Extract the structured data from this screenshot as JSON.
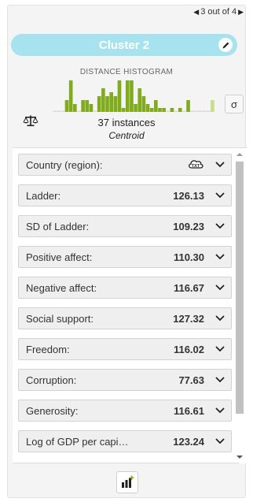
{
  "pager": {
    "text": "3 out of 4"
  },
  "cluster": {
    "name": "Cluster 2",
    "accent": "#a6e3ef"
  },
  "histogram": {
    "title": "DISTANCE HISTOGRAM",
    "bar_color": "#80ab1f",
    "highlight_color": "#c6de84",
    "empty_color": "#d8d8d8",
    "bins": [
      0,
      0,
      0,
      3,
      8,
      2,
      0,
      3,
      3,
      2,
      0,
      4,
      6,
      4,
      5,
      4,
      8,
      1,
      8,
      8,
      2,
      6,
      4,
      2,
      1,
      3,
      1,
      1,
      0,
      1,
      0,
      1,
      0,
      3,
      0,
      0,
      0,
      0,
      0,
      3
    ],
    "highlight_bins": [
      39
    ]
  },
  "sigma_button": {
    "label": "σ"
  },
  "summary": {
    "instances": "37 instances",
    "point": "Centroid"
  },
  "fields": [
    {
      "name": "Country (region):",
      "value": "",
      "icon": "txt-icon"
    },
    {
      "name": "Ladder:",
      "value": "126.13"
    },
    {
      "name": "SD of Ladder:",
      "value": "109.23"
    },
    {
      "name": "Positive affect:",
      "value": "110.30"
    },
    {
      "name": "Negative affect:",
      "value": "116.67"
    },
    {
      "name": "Social support:",
      "value": "127.32"
    },
    {
      "name": "Freedom:",
      "value": "116.02"
    },
    {
      "name": "Corruption:",
      "value": "77.63"
    },
    {
      "name": "Generosity:",
      "value": "116.61"
    },
    {
      "name": "Log of GDP per capi…",
      "value": "123.24"
    }
  ],
  "icons": {
    "prev": "chevron-left-icon",
    "next": "chevron-right-icon",
    "edit": "pencil-icon",
    "balance": "balance-scale-icon",
    "text_field": "txt-icon",
    "expand": "chevron-down-icon",
    "add_chart": "add-chart-icon"
  }
}
